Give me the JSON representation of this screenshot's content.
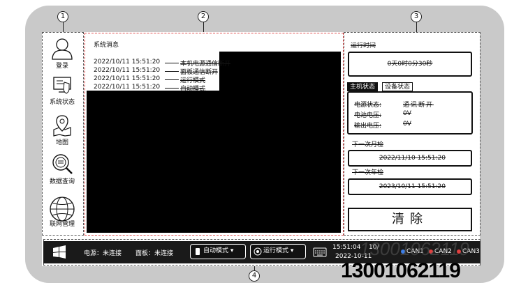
{
  "callouts": [
    "1",
    "2",
    "3",
    "4"
  ],
  "sidebar": {
    "items": [
      {
        "label": "登录",
        "icon": "user-icon"
      },
      {
        "label": "系统状态",
        "icon": "system-status-icon"
      },
      {
        "label": "地图",
        "icon": "map-icon"
      },
      {
        "label": "数据查询",
        "icon": "data-query-icon"
      },
      {
        "label": "联网管理",
        "icon": "network-globe-icon"
      }
    ]
  },
  "messages": {
    "title": "系统消息",
    "entries": [
      {
        "time": "2022/10/11 15:51:20",
        "text": "本机电源通信断开"
      },
      {
        "time": "2022/10/11 15:51:20",
        "text": "面板通信断开"
      },
      {
        "time": "2022/10/11 15:51:20",
        "text": "运行模式"
      },
      {
        "time": "2022/10/11 15:51:20",
        "text": "自动模式"
      }
    ]
  },
  "right_panel": {
    "runtime_label": "运行时间",
    "runtime_value": "0天0时0分30秒",
    "tabs": [
      {
        "label": "主机状态",
        "active": true
      },
      {
        "label": "设备状态",
        "active": false
      }
    ],
    "status": {
      "power_label": "电源状态:",
      "power_value": "通讯断开",
      "battery_label": "电池电压:",
      "battery_value": "0V",
      "output_label": "输出电压:",
      "output_value": "0V"
    },
    "next_monthly_label": "下一次月检",
    "next_monthly_value": "2022/11/10 15:51:20",
    "next_yearly_label": "下一次年检",
    "next_yearly_value": "2023/10/11 15:51:20",
    "clear_label": "清除"
  },
  "taskbar": {
    "power_status": "电源：未连接",
    "panel_status": "面板：未连接",
    "auto_mode": "自动模式",
    "run_mode": "运行模式",
    "time": "15:51:04",
    "date": "2022-10-11",
    "date_partial": "10/",
    "can": [
      "CAN1",
      "CAN2",
      "CAN3"
    ]
  },
  "watermark": {
    "phone": "13001062119",
    "phone_ghost": "13001062119"
  }
}
